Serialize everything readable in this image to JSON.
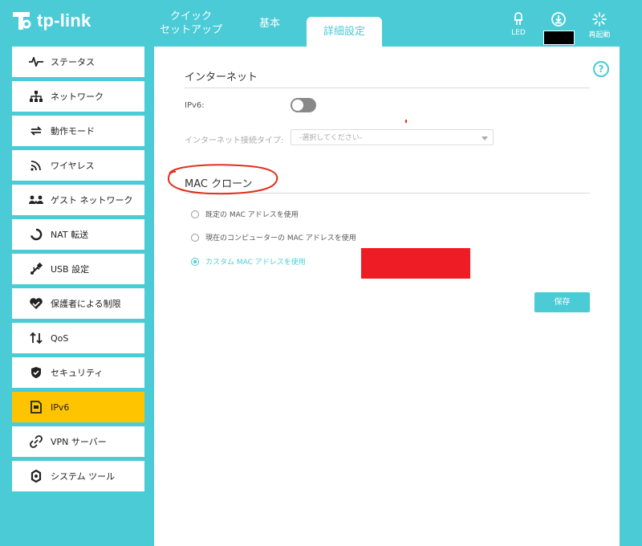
{
  "brand": {
    "name": "tp-link"
  },
  "tabs": [
    {
      "label_line1": "クイック",
      "label_line2": "セットアップ"
    },
    {
      "label": "基本"
    },
    {
      "label": "詳細設定"
    }
  ],
  "top_icons": {
    "led": "LED",
    "reboot": "再起動"
  },
  "sidebar": {
    "items": [
      {
        "label": "ステータス",
        "icon": "pulse-icon"
      },
      {
        "label": "ネットワーク",
        "icon": "network-icon"
      },
      {
        "label": "動作モード",
        "icon": "mode-icon"
      },
      {
        "label": "ワイヤレス",
        "icon": "wireless-icon"
      },
      {
        "label": "ゲスト ネットワーク",
        "icon": "guest-icon"
      },
      {
        "label": "NAT 転送",
        "icon": "nat-icon"
      },
      {
        "label": "USB 設定",
        "icon": "usb-icon"
      },
      {
        "label": "保護者による制限",
        "icon": "parental-icon"
      },
      {
        "label": "QoS",
        "icon": "qos-icon"
      },
      {
        "label": "セキュリティ",
        "icon": "shield-icon"
      },
      {
        "label": "IPv6",
        "icon": "ipv6-icon",
        "active": true
      },
      {
        "label": "VPN サーバー",
        "icon": "vpn-icon"
      },
      {
        "label": "システム ツール",
        "icon": "gear-icon"
      }
    ]
  },
  "internet": {
    "title": "インターネット",
    "ipv6_label": "IPv6:",
    "ipv6_enabled": false,
    "conn_type_label": "インターネット接続タイプ:",
    "conn_type_placeholder": "-選択してください-"
  },
  "mac_clone": {
    "title": "MAC クローン",
    "options": [
      {
        "label": "既定の MAC アドレスを使用",
        "checked": false
      },
      {
        "label": "現在のコンピューターの MAC アドレスを使用",
        "checked": false
      },
      {
        "label": "カスタム MAC アドレスを使用",
        "checked": true
      }
    ]
  },
  "save_label": "保存",
  "help_label": "?",
  "colors": {
    "accent": "#4acbd6",
    "active_menu": "#ffc400",
    "redaction": "#ee1c24",
    "annotation": "#e0301e"
  }
}
